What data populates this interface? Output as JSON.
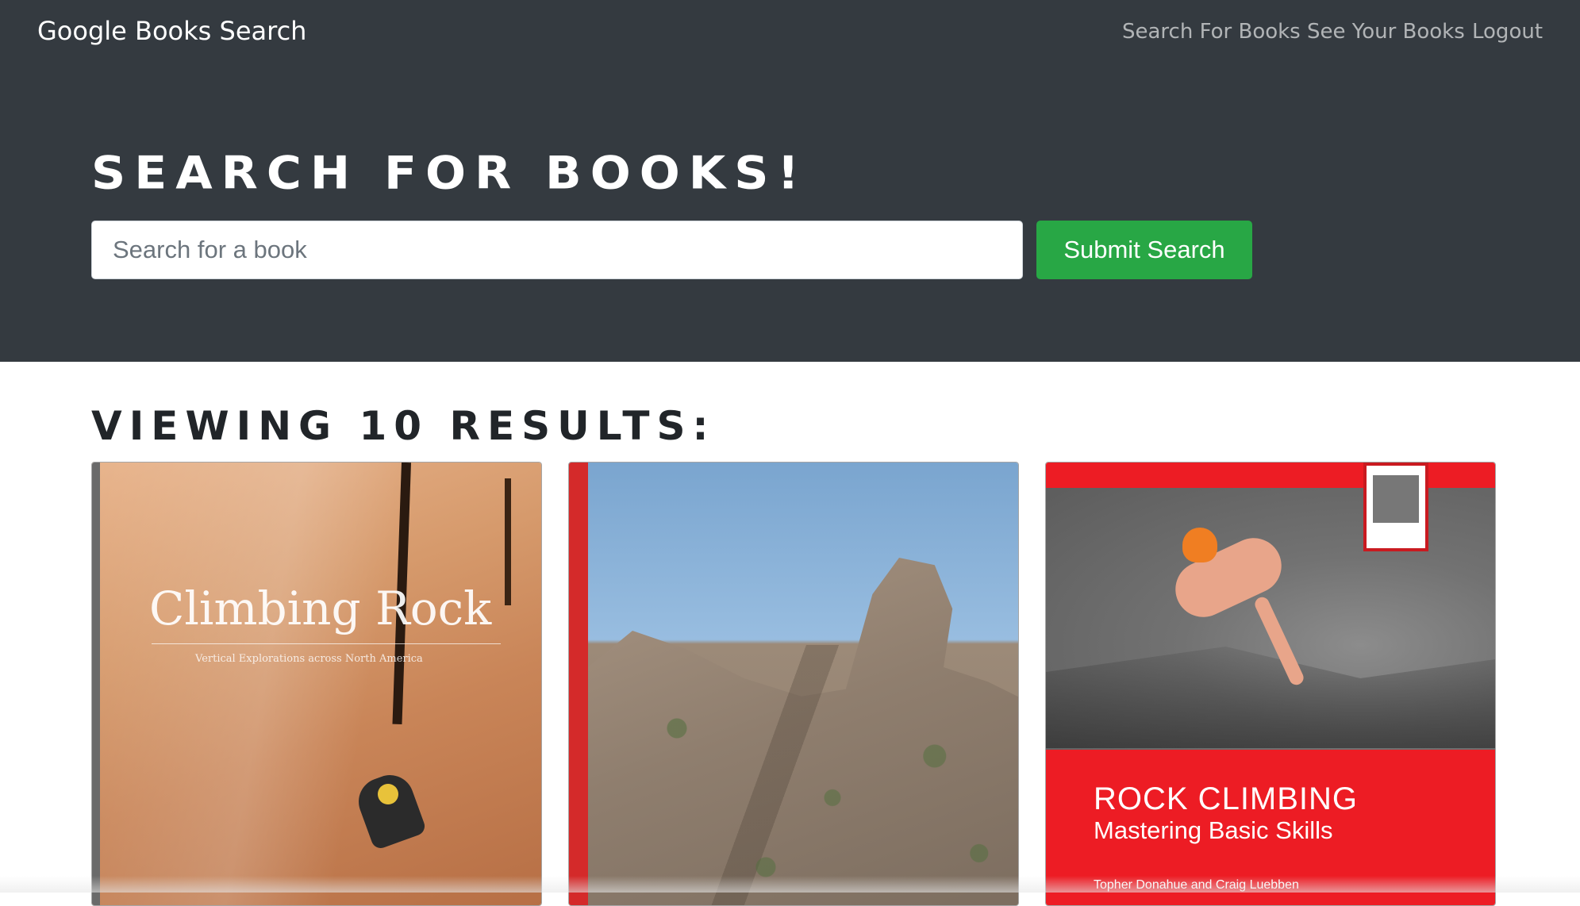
{
  "navbar": {
    "brand": "Google Books Search",
    "links": [
      {
        "label": "Search For Books"
      },
      {
        "label": "See Your Books"
      },
      {
        "label": "Logout"
      }
    ]
  },
  "hero": {
    "title": "Search for Books!",
    "search_placeholder": "Search for a book",
    "search_value": "",
    "submit_label": "Submit Search"
  },
  "results": {
    "heading": "Viewing 10 results:",
    "books": [
      {
        "cover_title": "Climbing Rock",
        "cover_subtitle": "Vertical Explorations across North America",
        "cover_color": "#c98558"
      },
      {
        "cover_title": "",
        "cover_color": "#8f7e6e",
        "spine_color": "#d42a2a"
      },
      {
        "cover_title": "ROCK CLIMBING",
        "cover_subtitle": "Mastering Basic Skills",
        "cover_authors": "Topher Donahue and Craig Luebben",
        "cover_color": "#ed1c24"
      }
    ]
  },
  "colors": {
    "navbar_bg": "#343a40",
    "submit_bg": "#28a745"
  }
}
